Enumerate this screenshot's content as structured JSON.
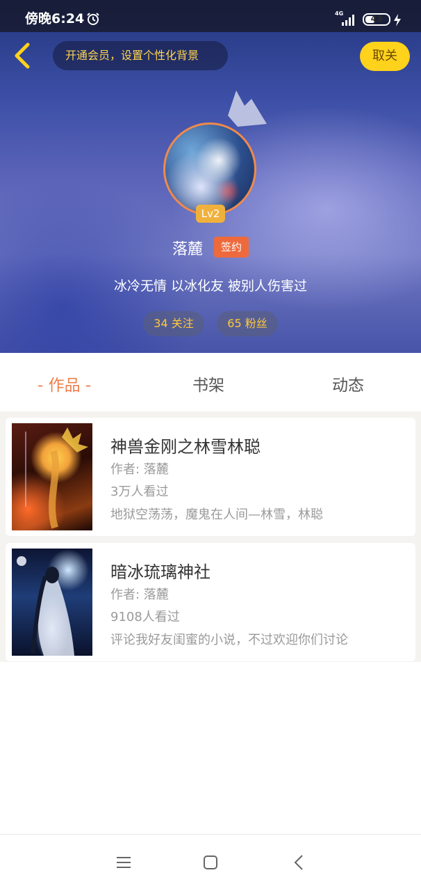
{
  "status_bar": {
    "time": "傍晚6:24",
    "network": "4G",
    "battery": "43",
    "battery_level": 0.43
  },
  "header": {
    "vip_prompt": "开通会员，设置个性化背景",
    "unfollow_label": "取关"
  },
  "profile": {
    "level": "Lv2",
    "name": "落麓",
    "badge": "签约",
    "bio": "冰冷无情 以冰化友 被别人伤害过",
    "following": "34 关注",
    "fans": "65 粉丝"
  },
  "tabs": [
    {
      "label": "- 作品 -",
      "active": true
    },
    {
      "label": "书架",
      "active": false
    },
    {
      "label": "动态",
      "active": false
    }
  ],
  "books": [
    {
      "title": "神兽金刚之林雪林聪",
      "author": "作者: 落麓",
      "views": "3万人看过",
      "description": "地狱空荡荡，魔鬼在人间—林雪，林聪"
    },
    {
      "title": "暗冰琉璃神社",
      "author": "作者: 落麓",
      "views": "9108人看过",
      "description": "评论我好友闺蜜的小说，不过欢迎你们讨论"
    }
  ],
  "colors": {
    "accent": "#ee7f4b",
    "gold": "#ffd21c",
    "badge": "#ee6a3c"
  },
  "icons": {
    "back": "chevron-left-icon",
    "alarm": "alarm-icon",
    "crown": "crown-icon",
    "nav_menu": "menu-icon",
    "nav_home": "square-home-icon",
    "nav_back": "back-arrow-icon"
  }
}
